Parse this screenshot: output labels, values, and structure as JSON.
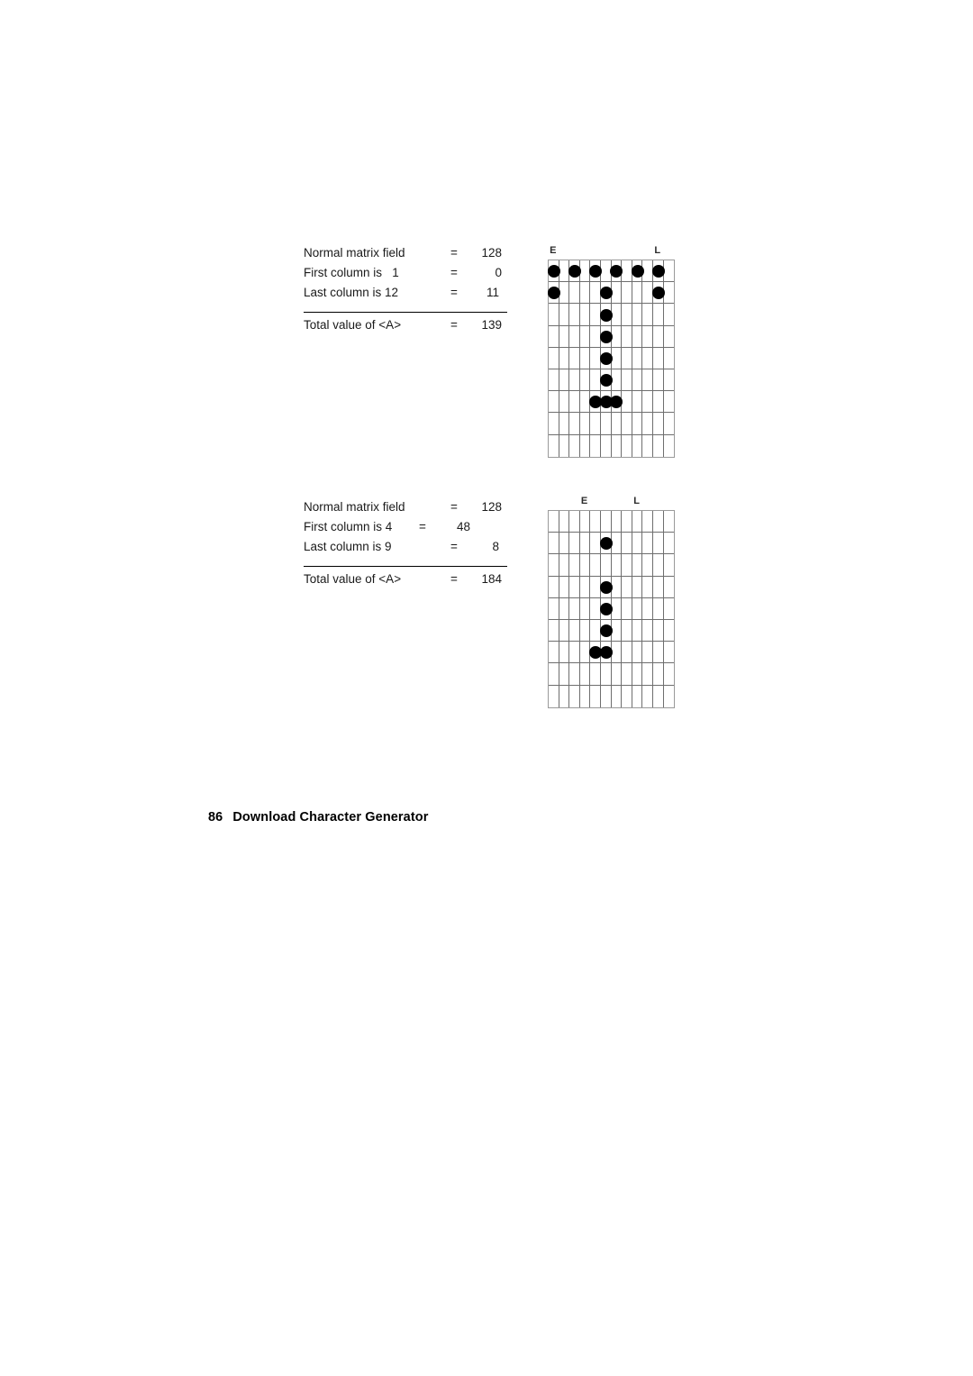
{
  "page": {
    "footer": {
      "page_number": "86",
      "title": "Download Character Generator"
    }
  },
  "examples": [
    {
      "id": "example-1",
      "rows": [
        {
          "label": "Normal matrix field",
          "eq": "=",
          "value": "128"
        },
        {
          "label": "First column is   1",
          "eq": "=",
          "value": "0"
        },
        {
          "label": "Last column is 12",
          "eq": "=",
          "value": "11"
        }
      ],
      "total": {
        "label": "Total value of <A>",
        "eq": "=",
        "value": "139"
      },
      "matrix": {
        "columns": 12,
        "rows": 9,
        "first_column_label": "E",
        "first_column_index": 1,
        "last_column_label": "L",
        "last_column_index": 11,
        "dots": [
          [
            1,
            1
          ],
          [
            1,
            3
          ],
          [
            1,
            5
          ],
          [
            1,
            7
          ],
          [
            1,
            9
          ],
          [
            1,
            11
          ],
          [
            2,
            1
          ],
          [
            2,
            6
          ],
          [
            2,
            11
          ],
          [
            3,
            6
          ],
          [
            4,
            6
          ],
          [
            5,
            6
          ],
          [
            6,
            6
          ],
          [
            7,
            5
          ],
          [
            7,
            6
          ],
          [
            7,
            7
          ]
        ]
      }
    },
    {
      "id": "example-2",
      "rows": [
        {
          "label": "Normal matrix field",
          "eq": "=",
          "value": "128"
        },
        {
          "label": "First column is 4",
          "eq": "=",
          "value": "48"
        },
        {
          "label": "Last column is 9",
          "eq": "=",
          "value": "8"
        }
      ],
      "total": {
        "label": "Total value of <A>",
        "eq": "=",
        "value": "184"
      },
      "matrix": {
        "columns": 12,
        "rows": 9,
        "first_column_label": "E",
        "first_column_index": 4,
        "last_column_label": "L",
        "last_column_index": 9,
        "dots": [
          [
            2,
            6
          ],
          [
            4,
            6
          ],
          [
            5,
            6
          ],
          [
            6,
            6
          ],
          [
            7,
            5
          ],
          [
            7,
            6
          ]
        ]
      }
    }
  ]
}
